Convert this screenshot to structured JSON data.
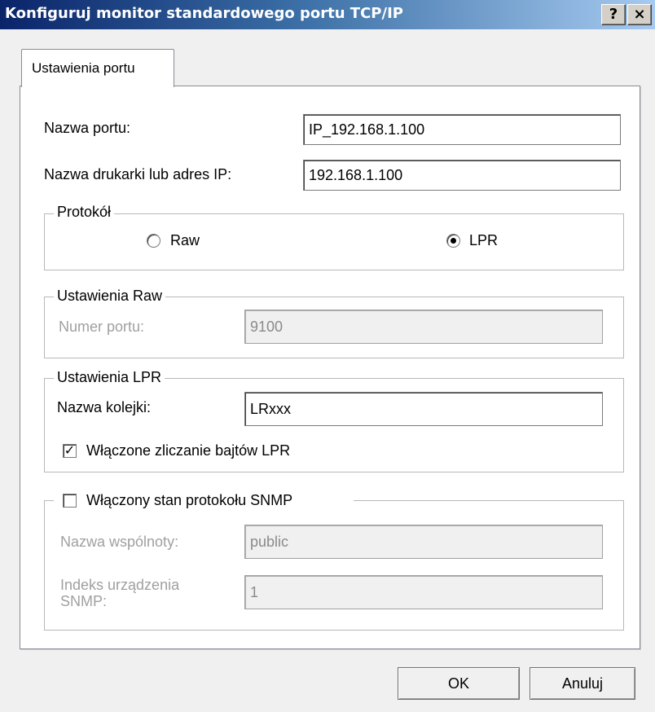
{
  "window": {
    "title": "Konfiguruj monitor standardowego portu TCP/IP",
    "help_label": "?",
    "close_label": "×"
  },
  "tabs": [
    {
      "label": "Ustawienia portu",
      "selected": true
    }
  ],
  "port": {
    "name_label": "Nazwa portu:",
    "name_value": "IP_192.168.1.100",
    "printer_label": "Nazwa drukarki lub adres IP:",
    "printer_value": "192.168.1.100"
  },
  "protocol": {
    "legend": "Protokół",
    "raw_label": "Raw",
    "lpr_label": "LPR",
    "selected": "LPR"
  },
  "raw_settings": {
    "legend": "Ustawienia Raw",
    "port_number_label": "Numer portu:",
    "port_number_value": "9100"
  },
  "lpr_settings": {
    "legend": "Ustawienia LPR",
    "queue_label": "Nazwa kolejki:",
    "queue_value": "LRxxx",
    "byte_count_label": "Włączone zliczanie bajtów LPR",
    "byte_count_checked": true
  },
  "snmp": {
    "legend": "Włączony stan protokołu SNMP",
    "enabled": false,
    "community_label": "Nazwa wspólnoty:",
    "community_value": "public",
    "device_index_label_line1": "Indeks urządzenia",
    "device_index_label_line2": "SNMP:",
    "device_index_value": "1"
  },
  "buttons": {
    "ok_label": "OK",
    "cancel_label": "Anuluj"
  },
  "colors": {
    "titlebar_start": "#0a246a",
    "titlebar_end": "#a6caf0",
    "disabled_text": "#a0a0a0"
  }
}
